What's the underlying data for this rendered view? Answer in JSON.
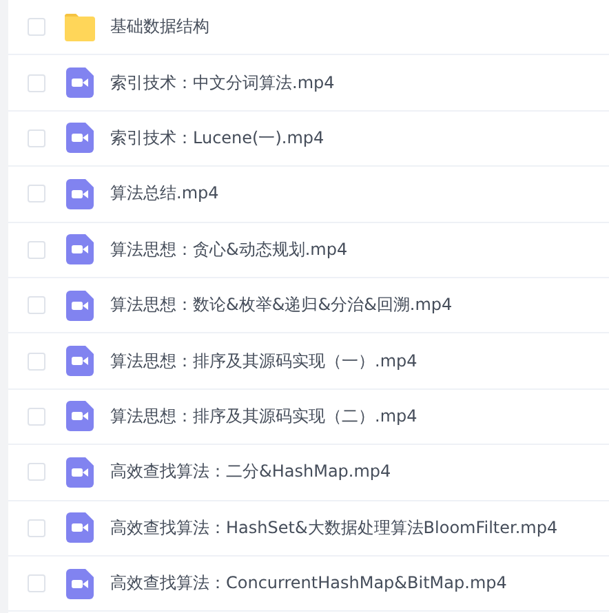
{
  "files": [
    {
      "kind": "folder",
      "name": "基础数据结构",
      "checked": false
    },
    {
      "kind": "video",
      "name": "索引技术：中文分词算法.mp4",
      "checked": false
    },
    {
      "kind": "video",
      "name": "索引技术：Lucene(一).mp4",
      "checked": false
    },
    {
      "kind": "video",
      "name": "算法总结.mp4",
      "checked": false
    },
    {
      "kind": "video",
      "name": "算法思想：贪心&动态规划.mp4",
      "checked": false
    },
    {
      "kind": "video",
      "name": "算法思想：数论&枚举&递归&分治&回溯.mp4",
      "checked": false
    },
    {
      "kind": "video",
      "name": "算法思想：排序及其源码实现（一）.mp4",
      "checked": false
    },
    {
      "kind": "video",
      "name": "算法思想：排序及其源码实现（二）.mp4",
      "checked": false
    },
    {
      "kind": "video",
      "name": "高效查找算法：二分&HashMap.mp4",
      "checked": false
    },
    {
      "kind": "video",
      "name": "高效查找算法：HashSet&大数据处理算法BloomFilter.mp4",
      "checked": false
    },
    {
      "kind": "video",
      "name": "高效查找算法：ConcurrentHashMap&BitMap.mp4",
      "checked": false
    }
  ]
}
